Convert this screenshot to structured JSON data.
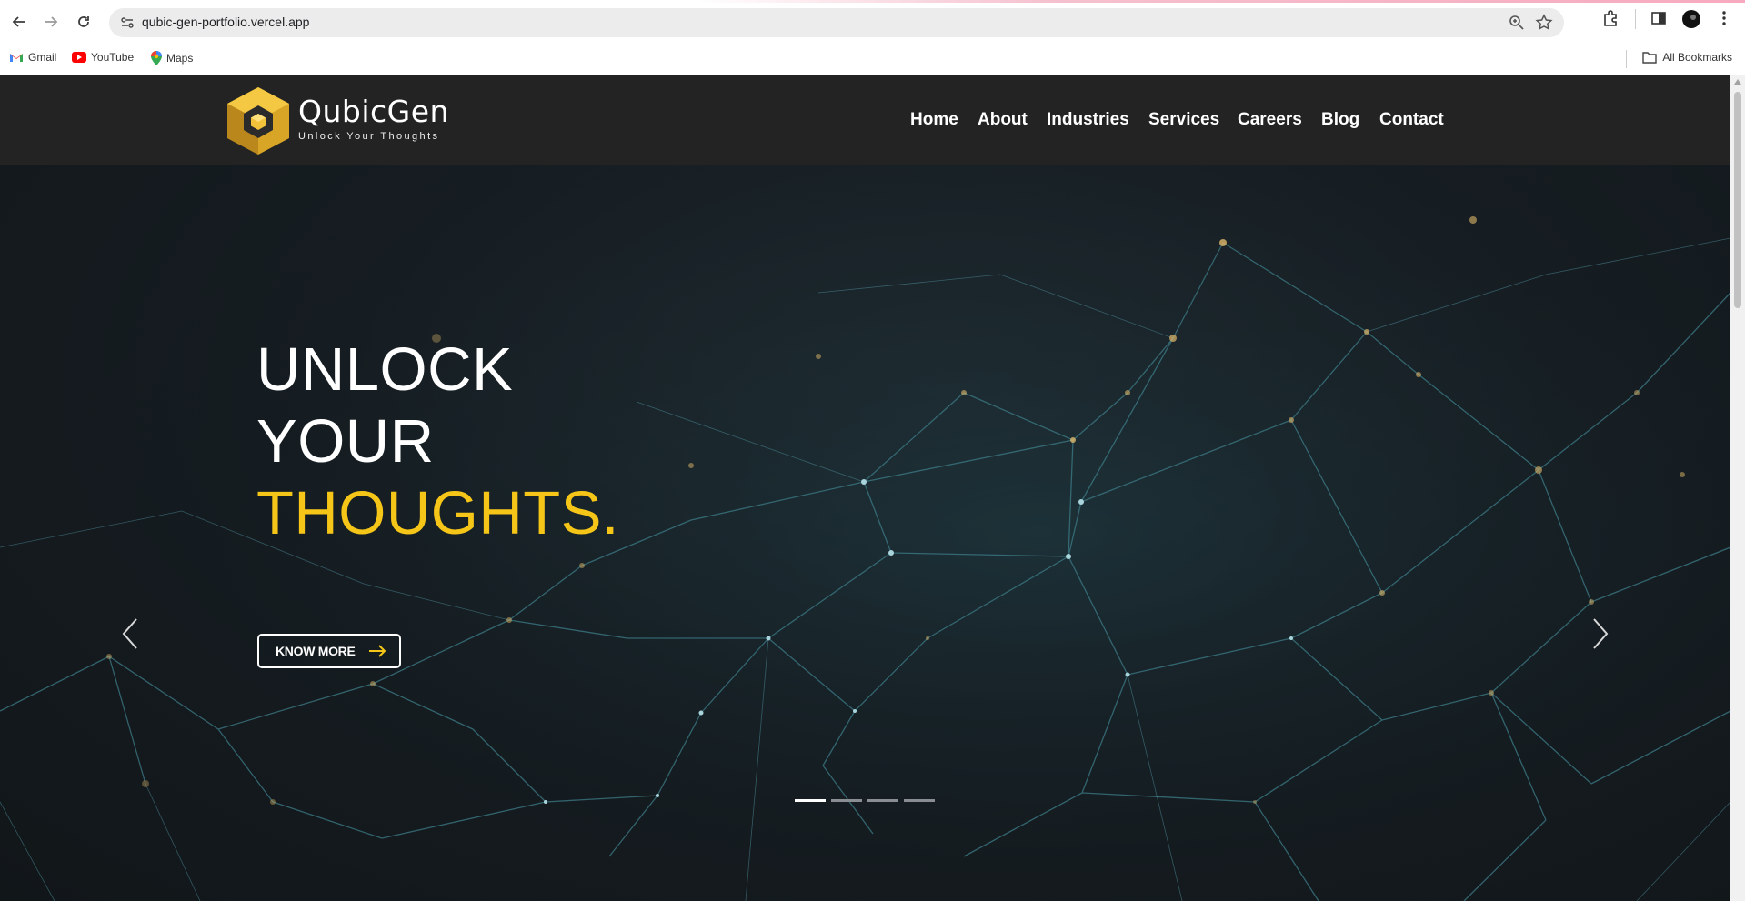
{
  "browser": {
    "url": "qubic-gen-portfolio.vercel.app",
    "bookmarks": [
      {
        "label": "Gmail",
        "icon": "gmail-icon"
      },
      {
        "label": "YouTube",
        "icon": "youtube-icon"
      },
      {
        "label": "Maps",
        "icon": "maps-icon"
      }
    ],
    "all_bookmarks_label": "All Bookmarks"
  },
  "site": {
    "brand_name": "QubicGen",
    "tagline": "Unlock Your Thoughts",
    "nav": [
      "Home",
      "About",
      "Industries",
      "Services",
      "Careers",
      "Blog",
      "Contact"
    ],
    "hero": {
      "line1": "UNLOCK",
      "line2": "YOUR",
      "line3": "THOUGHTS.",
      "cta": "KNOW MORE"
    },
    "carousel": {
      "slides": 4,
      "active": 1
    },
    "colors": {
      "accent": "#f5c518",
      "header": "#232323",
      "hero_bg": "#141a1e"
    }
  }
}
